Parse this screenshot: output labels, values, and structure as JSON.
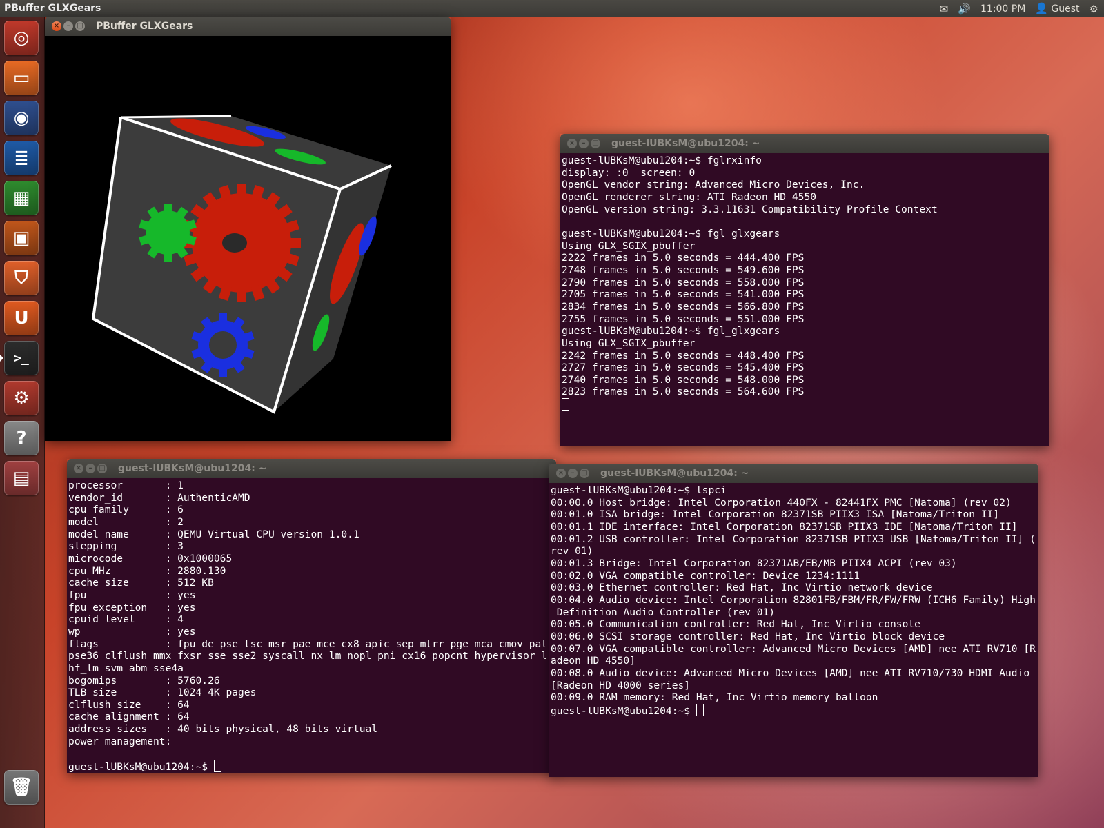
{
  "top_panel": {
    "app_title": "PBuffer GLXGears",
    "time": "11:00 PM",
    "user": "Guest",
    "icons": [
      "mail-icon",
      "volume-icon",
      "user-icon",
      "gear-icon"
    ]
  },
  "launcher": {
    "items": [
      {
        "name": "dash-home",
        "icon": "ubuntu-logo-icon",
        "color": "#c0392b"
      },
      {
        "name": "files",
        "icon": "folder-icon",
        "color": "#e86a24"
      },
      {
        "name": "firefox",
        "icon": "firefox-icon",
        "color": "#2f4f8f"
      },
      {
        "name": "libreoffice-writer",
        "icon": "writer-icon",
        "color": "#1f5aa6"
      },
      {
        "name": "libreoffice-calc",
        "icon": "calc-icon",
        "color": "#2e8b2e"
      },
      {
        "name": "libreoffice-impress",
        "icon": "impress-icon",
        "color": "#c0561b"
      },
      {
        "name": "software-center",
        "icon": "shopping-bag-icon",
        "color": "#e0602a"
      },
      {
        "name": "ubuntu-one",
        "icon": "ubuntu-one-icon",
        "color": "#e05a20"
      },
      {
        "name": "terminal",
        "icon": "terminal-icon",
        "color": "#2c2c2c"
      },
      {
        "name": "system-settings",
        "icon": "settings-icon",
        "color": "#b03a2e"
      },
      {
        "name": "help",
        "icon": "help-icon",
        "color": "#888888"
      },
      {
        "name": "workspace-switcher",
        "icon": "workspaces-icon",
        "color": "#a04040"
      },
      {
        "name": "trash",
        "icon": "trash-icon",
        "color": "#777777"
      }
    ]
  },
  "gears_window": {
    "title": "PBuffer GLXGears"
  },
  "terminal_fps": {
    "title": "guest-lUBKsM@ubu1204: ~",
    "lines": [
      "guest-lUBKsM@ubu1204:~$ fglrxinfo",
      "display: :0  screen: 0",
      "OpenGL vendor string: Advanced Micro Devices, Inc.",
      "OpenGL renderer string: ATI Radeon HD 4550",
      "OpenGL version string: 3.3.11631 Compatibility Profile Context",
      "",
      "guest-lUBKsM@ubu1204:~$ fgl_glxgears",
      "Using GLX_SGIX_pbuffer",
      "2222 frames in 5.0 seconds = 444.400 FPS",
      "2748 frames in 5.0 seconds = 549.600 FPS",
      "2790 frames in 5.0 seconds = 558.000 FPS",
      "2705 frames in 5.0 seconds = 541.000 FPS",
      "2834 frames in 5.0 seconds = 566.800 FPS",
      "2755 frames in 5.0 seconds = 551.000 FPS",
      "guest-lUBKsM@ubu1204:~$ fgl_glxgears",
      "Using GLX_SGIX_pbuffer",
      "2242 frames in 5.0 seconds = 448.400 FPS",
      "2727 frames in 5.0 seconds = 545.400 FPS",
      "2740 frames in 5.0 seconds = 548.000 FPS",
      "2823 frames in 5.0 seconds = 564.600 FPS"
    ]
  },
  "terminal_cpu": {
    "title": "guest-lUBKsM@ubu1204: ~",
    "lines": [
      "processor       : 1",
      "vendor_id       : AuthenticAMD",
      "cpu family      : 6",
      "model           : 2",
      "model name      : QEMU Virtual CPU version 1.0.1",
      "stepping        : 3",
      "microcode       : 0x1000065",
      "cpu MHz         : 2880.130",
      "cache size      : 512 KB",
      "fpu             : yes",
      "fpu_exception   : yes",
      "cpuid level     : 4",
      "wp              : yes",
      "flags           : fpu de pse tsc msr pae mce cx8 apic sep mtrr pge mca cmov pat",
      "pse36 clflush mmx fxsr sse sse2 syscall nx lm nopl pni cx16 popcnt hypervisor l",
      "hf_lm svm abm sse4a",
      "bogomips        : 5760.26",
      "TLB size        : 1024 4K pages",
      "clflush size    : 64",
      "cache_alignment : 64",
      "address sizes   : 40 bits physical, 48 bits virtual",
      "power management:",
      ""
    ],
    "prompt": "guest-lUBKsM@ubu1204:~$ "
  },
  "terminal_lspci": {
    "title": "guest-lUBKsM@ubu1204: ~",
    "lines": [
      "guest-lUBKsM@ubu1204:~$ lspci",
      "00:00.0 Host bridge: Intel Corporation 440FX - 82441FX PMC [Natoma] (rev 02)",
      "00:01.0 ISA bridge: Intel Corporation 82371SB PIIX3 ISA [Natoma/Triton II]",
      "00:01.1 IDE interface: Intel Corporation 82371SB PIIX3 IDE [Natoma/Triton II]",
      "00:01.2 USB controller: Intel Corporation 82371SB PIIX3 USB [Natoma/Triton II] (",
      "rev 01)",
      "00:01.3 Bridge: Intel Corporation 82371AB/EB/MB PIIX4 ACPI (rev 03)",
      "00:02.0 VGA compatible controller: Device 1234:1111",
      "00:03.0 Ethernet controller: Red Hat, Inc Virtio network device",
      "00:04.0 Audio device: Intel Corporation 82801FB/FBM/FR/FW/FRW (ICH6 Family) High",
      " Definition Audio Controller (rev 01)",
      "00:05.0 Communication controller: Red Hat, Inc Virtio console",
      "00:06.0 SCSI storage controller: Red Hat, Inc Virtio block device",
      "00:07.0 VGA compatible controller: Advanced Micro Devices [AMD] nee ATI RV710 [R",
      "adeon HD 4550]",
      "00:08.0 Audio device: Advanced Micro Devices [AMD] nee ATI RV710/730 HDMI Audio",
      "[Radeon HD 4000 series]",
      "00:09.0 RAM memory: Red Hat, Inc Virtio memory balloon"
    ],
    "prompt": "guest-lUBKsM@ubu1204:~$ "
  },
  "window_buttons": {
    "close": "×",
    "minimize": "–",
    "maximize": "□"
  }
}
